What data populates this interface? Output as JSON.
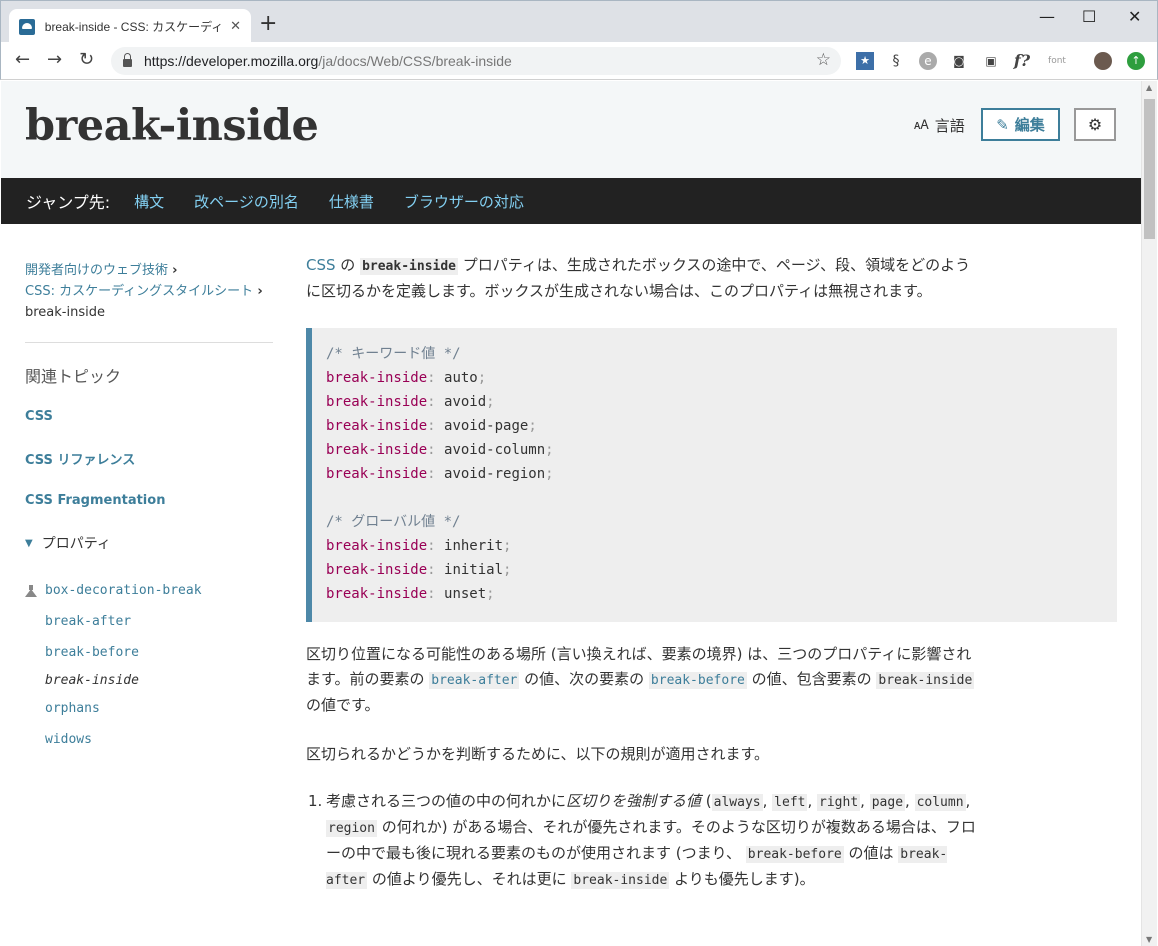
{
  "browser": {
    "tab_title": "break-inside - CSS: カスケーディング",
    "tab_close": "✕",
    "new_tab": "+",
    "win_min": "—",
    "win_max": "☐",
    "win_close": "✕",
    "url_host": "https://developer.mozilla.org",
    "url_path": "/ja/docs/Web/CSS/break-inside",
    "ext_font_label": "font"
  },
  "header": {
    "title": "break-inside",
    "language_label": "言語",
    "edit_label": "編集"
  },
  "jumpbar": {
    "label": "ジャンプ先:",
    "links": [
      "構文",
      "改ページの別名",
      "仕様書",
      "ブラウザーの対応"
    ]
  },
  "sidebar": {
    "breadcrumb": [
      "開発者向けのウェブ技術",
      "CSS: カスケーディングスタイルシート",
      "break-inside"
    ],
    "topics_title": "関連トピック",
    "links": [
      "CSS",
      "CSS リファレンス",
      "CSS Fragmentation"
    ],
    "group_label": "プロパティ",
    "properties": [
      "box-decoration-break",
      "break-after",
      "break-before",
      "break-inside",
      "orphans",
      "widows"
    ]
  },
  "main": {
    "intro": {
      "css_link": "CSS",
      "t1": " の ",
      "prop": "break-inside",
      "t2": " プロパティは、生成されたボックスの途中で、ページ、段、領域をどのように区切るかを定義します。ボックスが生成されない場合は、このプロパティは無視されます。"
    },
    "code": {
      "comment1": "/* キーワード値 */",
      "comment2": "/* グローバル値 */",
      "prop": "break-inside",
      "keywords": [
        "auto",
        "avoid",
        "avoid-page",
        "avoid-column",
        "avoid-region"
      ],
      "globals": [
        "inherit",
        "initial",
        "unset"
      ]
    },
    "p2": {
      "t1": "区切り位置になる可能性のある場所 (言い換えれば、要素の境界) は、三つのプロパティに影響されます。前の要素の ",
      "c1": "break-after",
      "t2": " の値、次の要素の ",
      "c2": "break-before",
      "t3": " の値、包含要素の ",
      "c3": "break-inside",
      "t4": " の値です。"
    },
    "p3": "区切られるかどうかを判断するために、以下の規則が適用されます。",
    "li1": {
      "num": "1.",
      "t1": "考慮される三つの値の中の何れかに",
      "em": "区切りを強制する値",
      "t2": " (",
      "v1": "always",
      "v2": "left",
      "v3": "right",
      "v4": "page",
      "v5": "column",
      "v6": "region",
      "t3": " の何れか) がある場合、それが優先されます。そのような区切りが複数ある場合は、フローの中で最も後に現れる要素のものが使用されます (つまり、 ",
      "c1": "break-before",
      "t4": " の値は ",
      "c2": "break-after",
      "t5": " の値より優先し、それは更に ",
      "c3": "break-inside",
      "t6": " よりも優先します)。",
      "comma": ", "
    }
  }
}
